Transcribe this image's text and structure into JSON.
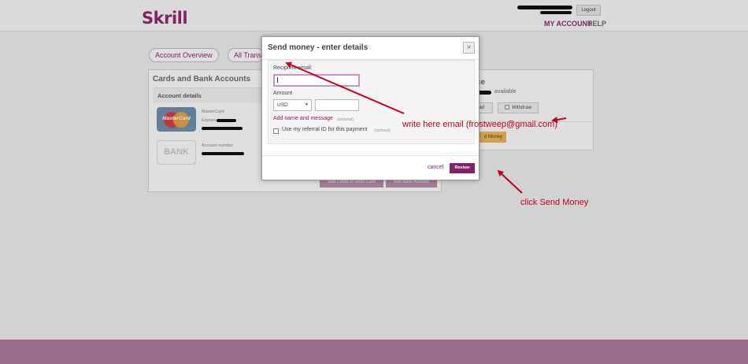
{
  "header": {
    "logo": "Skrill",
    "logout_label": "Logout",
    "nav": {
      "my_account": "MY ACCOUNT",
      "help": "HELP"
    }
  },
  "tabs": {
    "account_overview": "Account Overview",
    "all_transactions": "All Trans"
  },
  "cards_panel": {
    "title": "Cards and Bank Accounts",
    "account_details": "Account details",
    "card_type": "MasterCard",
    "card_brand": "MasterCard",
    "expires_label": "Expires",
    "bank_label": "BANK",
    "account_number_label": "Account number",
    "add_card_button": "Add Credit or Debit Card",
    "add_bank_button": "Add Bank Account"
  },
  "balance_panel": {
    "title_fragment": "ce",
    "available_label": "available",
    "upload_fragment": "oad",
    "withdraw_label": "Withdraw",
    "send_money_fragment": "d Money"
  },
  "modal": {
    "title": "Send money - enter details",
    "close_icon": "×",
    "recipient_label": "Recipient email:",
    "recipient_value": "",
    "amount_label": "Amount",
    "currency": "USD",
    "amount_value": "",
    "add_name_link": "Add name and message",
    "optional_1": "(optional)",
    "referral_label": "Use my referral ID for this payment",
    "optional_2": "(optional)",
    "cancel_label": "cancel",
    "review_label": "Review"
  },
  "annotations": {
    "email_hint": "write here email (frostweep@gmail.com)",
    "send_hint": "click Send Money"
  },
  "colors": {
    "brand": "#862165",
    "annotation": "#c40024",
    "footer": "#9b6b8a"
  },
  "icons": [
    "close-icon",
    "chevron-down-icon",
    "checkbox-icon",
    "withdraw-icon",
    "mastercard-icon",
    "bank-icon"
  ]
}
